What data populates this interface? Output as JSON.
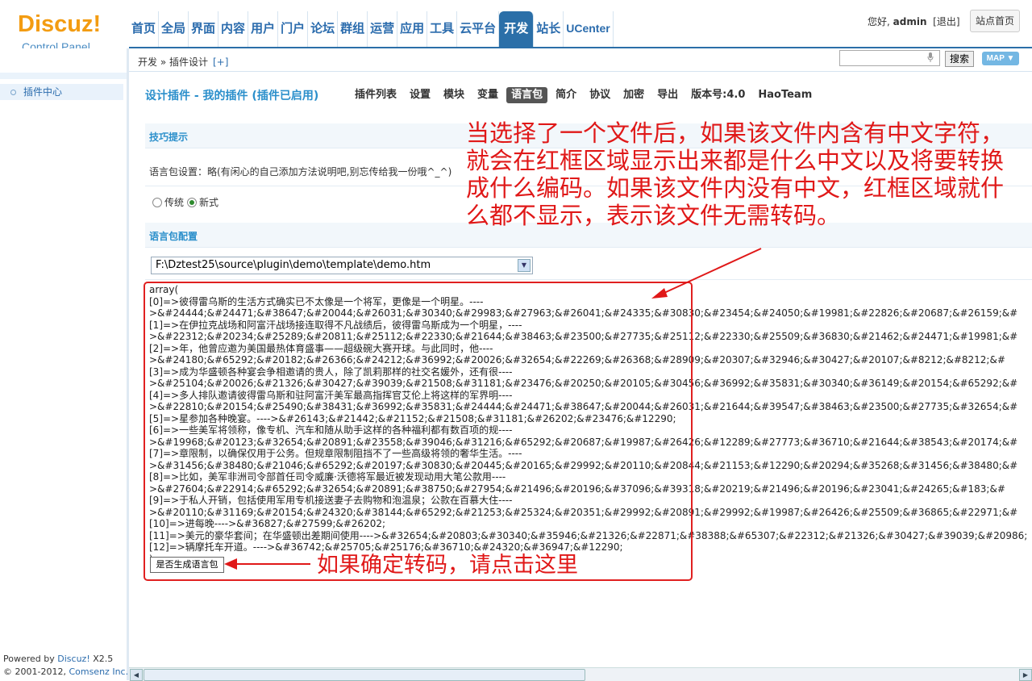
{
  "header": {
    "logo_word": "Discuz!",
    "logo_sub": "Control Panel",
    "nav": [
      "首页",
      "全局",
      "界面",
      "内容",
      "用户",
      "门户",
      "论坛",
      "群组",
      "运营",
      "应用",
      "工具",
      "云平台",
      "开发",
      "站长",
      "UCenter"
    ],
    "nav_active": "开发",
    "greeting": "您好,",
    "username": "admin",
    "logout": "[退出]",
    "site_home": "站点首页"
  },
  "breadcrumb": {
    "text": "开发 » 插件设计",
    "add": "[+]"
  },
  "search": {
    "button": "搜索",
    "map": "MAP ▼"
  },
  "sidebar": {
    "item": "插件中心",
    "powered_prefix": "Powered by ",
    "powered_brand": "Discuz!",
    "powered_version": " X2.5",
    "copyright_prefix": "© 2001-2012, ",
    "copyright_brand": "Comsenz Inc."
  },
  "main": {
    "title": "设计插件 - 我的插件 (插件已启用)",
    "subnav": [
      "插件列表",
      "设置",
      "模块",
      "变量",
      "语言包",
      "简介",
      "协议",
      "加密",
      "导出",
      "版本号:4.0",
      "HaoTeam"
    ],
    "subnav_active": "语言包",
    "tips_heading": "技巧提示",
    "tips_text": "语言包设置：略(有闲心的自己添加方法说明吧,别忘传给我一份哦^_^)",
    "radio_traditional": "传统",
    "radio_new": "新式",
    "config_heading": "语言包配置",
    "file_path": "F:\\Dztest25\\source\\plugin\\demo\\template\\demo.htm",
    "code_lines": [
      "array(",
      "[0]=>彼得雷乌斯的生活方式确实已不太像是一个将军，更像是一个明星。----",
      ">&#24444;&#24471;&#38647;&#20044;&#26031;&#30340;&#29983;&#27963;&#26041;&#24335;&#30830;&#23454;&#24050;&#19981;&#22826;&#20687;&#26159;&#",
      "[1]=>在伊拉克战场和阿富汗战场接连取得不凡战绩后，彼得雷乌斯成为一个明星，----",
      ">&#22312;&#20234;&#25289;&#20811;&#25112;&#22330;&#21644;&#38463;&#23500;&#27735;&#25112;&#22330;&#25509;&#36830;&#21462;&#24471;&#19981;&#",
      "[2]=>年，他曾应邀为美国最热体育盛事——超级碗大赛开球。与此同时，他----",
      ">&#24180;&#65292;&#20182;&#26366;&#24212;&#36992;&#20026;&#32654;&#22269;&#26368;&#28909;&#20307;&#32946;&#30427;&#20107;&#8212;&#8212;&#",
      "[3]=>成为华盛顿各种宴会争相邀请的贵人，除了凯莉那样的社交名媛外，还有很----",
      ">&#25104;&#20026;&#21326;&#30427;&#39039;&#21508;&#31181;&#23476;&#20250;&#20105;&#30456;&#36992;&#35831;&#30340;&#36149;&#20154;&#65292;&#",
      "[4]=>多人排队邀请彼得雷乌斯和驻阿富汗美军最高指挥官艾伦上将这样的军界明----",
      ">&#22810;&#20154;&#25490;&#38431;&#36992;&#35831;&#24444;&#24471;&#38647;&#20044;&#26031;&#21644;&#39547;&#38463;&#23500;&#27735;&#32654;&#",
      "[5]=>星参加各种晚宴。---->&#26143;&#21442;&#21152;&#21508;&#31181;&#26202;&#23476;&#12290;",
      "[6]=>一些美军将领称，像专机、汽车和随从助手这样的各种福利都有数百项的规----",
      ">&#19968;&#20123;&#32654;&#20891;&#23558;&#39046;&#31216;&#65292;&#20687;&#19987;&#26426;&#12289;&#27773;&#36710;&#21644;&#38543;&#20174;&#",
      "[7]=>章限制，以确保仅用于公务。但规章限制阻挡不了一些高级将领的奢华生活。----",
      ">&#31456;&#38480;&#21046;&#65292;&#20197;&#30830;&#20445;&#20165;&#29992;&#20110;&#20844;&#21153;&#12290;&#20294;&#35268;&#31456;&#38480;&#",
      "[8]=>比如，美军非洲司令部首任司令威廉·沃德将军最近被发现动用大笔公款用----",
      ">&#27604;&#22914;&#65292;&#32654;&#20891;&#38750;&#27954;&#21496;&#20196;&#37096;&#39318;&#20219;&#21496;&#20196;&#23041;&#24265;&#183;&#",
      "[9]=>于私人开销，包括使用军用专机接送妻子去购物和泡温泉；公款在百慕大住----",
      ">&#20110;&#31169;&#20154;&#24320;&#38144;&#65292;&#21253;&#25324;&#20351;&#29992;&#20891;&#29992;&#19987;&#26426;&#25509;&#36865;&#22971;&#",
      "[10]=>进每晚---->&#36827;&#27599;&#26202;",
      "[11]=>美元的豪华套间；在华盛顿出差期间使用---->&#32654;&#20803;&#30340;&#35946;&#21326;&#22871;&#38388;&#65307;&#22312;&#21326;&#30427;&#39039;&#20986;",
      "[12]=>辆摩托车开道。---->&#36742;&#25705;&#25176;&#36710;&#24320;&#36947;&#12290;",
      ");"
    ],
    "generate_button": "是否生成语言包"
  },
  "annotations": {
    "top": "当选择了一个文件后，如果该文件内含有中文字符，就会在红框区域显示出来都是什么中文以及将要转换成什么编码。如果该文件内没有中文，红框区域就什么都不显示，表示该文件无需转码。",
    "bottom": "如果确定转码，请点击这里",
    "color": "#e01818"
  }
}
